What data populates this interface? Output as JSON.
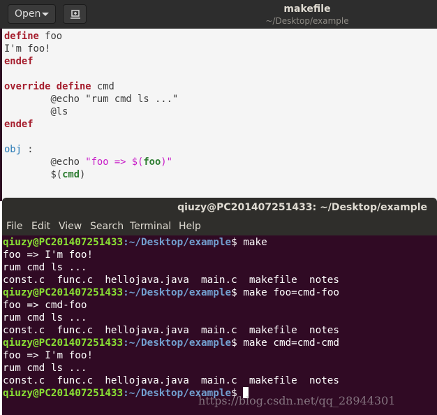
{
  "editor": {
    "open_label": "Open",
    "title": "makefile",
    "subtitle": "~/Desktop/example",
    "code": {
      "l1_kw": "define",
      "l1_name": " foo",
      "l2": "I'm foo!",
      "l3_kw": "endef",
      "l5_kw1": "override",
      "l5_kw2": "define",
      "l5_name": " cmd",
      "l6": "        @echo \"rum cmd ls ...\"",
      "l7": "        @ls",
      "l8_kw": "endef",
      "l10_target": "obj",
      "l10_rest": " :",
      "l11_prefix": "        @echo ",
      "l11_str1": "\"foo => $(",
      "l11_var": "foo",
      "l11_str2": ")\"",
      "l12_prefix": "        $(",
      "l12_var": "cmd",
      "l12_suffix": ")"
    }
  },
  "terminal": {
    "title": "qiuzy@PC201407251433: ~/Desktop/example",
    "menu": [
      "File",
      "Edit",
      "View",
      "Search",
      "Terminal",
      "Help"
    ],
    "prompt_user": "qiuzy@PC201407251433",
    "prompt_path": ":~/Desktop/example",
    "prompt_suffix": "$ ",
    "blocks": [
      {
        "command": "make",
        "output": [
          "foo => I'm foo!",
          "rum cmd ls ...",
          "const.c  func.c  hellojava.java  main.c  makefile  notes"
        ]
      },
      {
        "command": "make foo=cmd-foo",
        "output": [
          "foo => cmd-foo",
          "rum cmd ls ...",
          "const.c  func.c  hellojava.java  main.c  makefile  notes"
        ]
      },
      {
        "command": "make cmd=cmd-cmd",
        "output": [
          "foo => I'm foo!",
          "rum cmd ls ...",
          "const.c  func.c  hellojava.java  main.c  makefile  notes"
        ]
      }
    ]
  },
  "watermark": "https://blog.csdn.net/qq_28944301",
  "colors": {
    "keyword": "#a51d2d",
    "target": "#2a7bb6",
    "string": "#c71ac7",
    "variable": "#2e7d32",
    "terminal_bg": "#300a24",
    "prompt_user": "#8ae234",
    "prompt_path": "#729fcf"
  },
  "icons": {
    "pin": "pin-icon",
    "open_dropdown": "chevron-down-icon"
  }
}
